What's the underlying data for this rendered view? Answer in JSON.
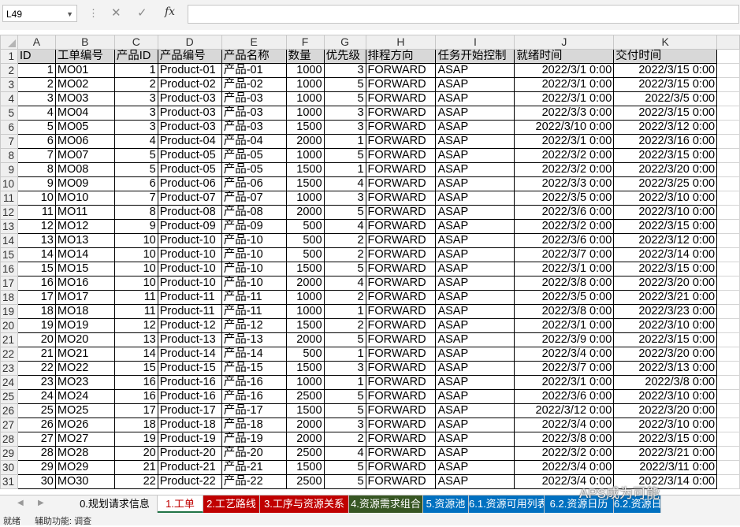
{
  "formula_bar": {
    "name_box": "L49",
    "fx_label": "fx",
    "formula": ""
  },
  "columns": [
    "A",
    "B",
    "C",
    "D",
    "E",
    "F",
    "G",
    "H",
    "I",
    "J",
    "K"
  ],
  "row_numbers": [
    "1",
    "2",
    "3",
    "4",
    "5",
    "6",
    "7",
    "8",
    "9",
    "10",
    "11",
    "12",
    "13",
    "14",
    "15",
    "16",
    "17",
    "18",
    "19",
    "20",
    "21",
    "22",
    "23",
    "24",
    "25",
    "26",
    "27",
    "28",
    "29",
    "30",
    "31"
  ],
  "header": [
    "ID",
    "工单编号",
    "产品ID",
    "产品编号",
    "产品名称",
    "数量",
    "优先级",
    "排程方向",
    "任务开始控制",
    "就绪时间",
    "交付时间"
  ],
  "rows": [
    [
      "1",
      "MO01",
      "1",
      "Product-01",
      "产品-01",
      "1000",
      "3",
      "FORWARD",
      "ASAP",
      "2022/3/1 0:00",
      "2022/3/15 0:00"
    ],
    [
      "2",
      "MO02",
      "2",
      "Product-02",
      "产品-02",
      "1000",
      "5",
      "FORWARD",
      "ASAP",
      "2022/3/1 0:00",
      "2022/3/15 0:00"
    ],
    [
      "3",
      "MO03",
      "3",
      "Product-03",
      "产品-03",
      "1000",
      "5",
      "FORWARD",
      "ASAP",
      "2022/3/1 0:00",
      "2022/3/5 0:00"
    ],
    [
      "4",
      "MO04",
      "3",
      "Product-03",
      "产品-03",
      "1000",
      "3",
      "FORWARD",
      "ASAP",
      "2022/3/3 0:00",
      "2022/3/15 0:00"
    ],
    [
      "5",
      "MO05",
      "3",
      "Product-03",
      "产品-03",
      "1500",
      "3",
      "FORWARD",
      "ASAP",
      "2022/3/10 0:00",
      "2022/3/12 0:00"
    ],
    [
      "6",
      "MO06",
      "4",
      "Product-04",
      "产品-04",
      "2000",
      "1",
      "FORWARD",
      "ASAP",
      "2022/3/1 0:00",
      "2022/3/16 0:00"
    ],
    [
      "7",
      "MO07",
      "5",
      "Product-05",
      "产品-05",
      "1000",
      "5",
      "FORWARD",
      "ASAP",
      "2022/3/2 0:00",
      "2022/3/15 0:00"
    ],
    [
      "8",
      "MO08",
      "5",
      "Product-05",
      "产品-05",
      "1500",
      "1",
      "FORWARD",
      "ASAP",
      "2022/3/2 0:00",
      "2022/3/20 0:00"
    ],
    [
      "9",
      "MO09",
      "6",
      "Product-06",
      "产品-06",
      "1500",
      "4",
      "FORWARD",
      "ASAP",
      "2022/3/3 0:00",
      "2022/3/25 0:00"
    ],
    [
      "10",
      "MO10",
      "7",
      "Product-07",
      "产品-07",
      "1000",
      "3",
      "FORWARD",
      "ASAP",
      "2022/3/5 0:00",
      "2022/3/10 0:00"
    ],
    [
      "11",
      "MO11",
      "8",
      "Product-08",
      "产品-08",
      "2000",
      "5",
      "FORWARD",
      "ASAP",
      "2022/3/6 0:00",
      "2022/3/10 0:00"
    ],
    [
      "12",
      "MO12",
      "9",
      "Product-09",
      "产品-09",
      "500",
      "4",
      "FORWARD",
      "ASAP",
      "2022/3/2 0:00",
      "2022/3/15 0:00"
    ],
    [
      "13",
      "MO13",
      "10",
      "Product-10",
      "产品-10",
      "500",
      "2",
      "FORWARD",
      "ASAP",
      "2022/3/6 0:00",
      "2022/3/12 0:00"
    ],
    [
      "14",
      "MO14",
      "10",
      "Product-10",
      "产品-10",
      "500",
      "2",
      "FORWARD",
      "ASAP",
      "2022/3/7 0:00",
      "2022/3/14 0:00"
    ],
    [
      "15",
      "MO15",
      "10",
      "Product-10",
      "产品-10",
      "1500",
      "5",
      "FORWARD",
      "ASAP",
      "2022/3/1 0:00",
      "2022/3/15 0:00"
    ],
    [
      "16",
      "MO16",
      "10",
      "Product-10",
      "产品-10",
      "2000",
      "4",
      "FORWARD",
      "ASAP",
      "2022/3/8 0:00",
      "2022/3/20 0:00"
    ],
    [
      "17",
      "MO17",
      "11",
      "Product-11",
      "产品-11",
      "1000",
      "2",
      "FORWARD",
      "ASAP",
      "2022/3/5 0:00",
      "2022/3/21 0:00"
    ],
    [
      "18",
      "MO18",
      "11",
      "Product-11",
      "产品-11",
      "1000",
      "1",
      "FORWARD",
      "ASAP",
      "2022/3/8 0:00",
      "2022/3/23 0:00"
    ],
    [
      "19",
      "MO19",
      "12",
      "Product-12",
      "产品-12",
      "1500",
      "2",
      "FORWARD",
      "ASAP",
      "2022/3/1 0:00",
      "2022/3/10 0:00"
    ],
    [
      "20",
      "MO20",
      "13",
      "Product-13",
      "产品-13",
      "2000",
      "5",
      "FORWARD",
      "ASAP",
      "2022/3/9 0:00",
      "2022/3/15 0:00"
    ],
    [
      "21",
      "MO21",
      "14",
      "Product-14",
      "产品-14",
      "500",
      "1",
      "FORWARD",
      "ASAP",
      "2022/3/4 0:00",
      "2022/3/20 0:00"
    ],
    [
      "22",
      "MO22",
      "15",
      "Product-15",
      "产品-15",
      "1500",
      "3",
      "FORWARD",
      "ASAP",
      "2022/3/7 0:00",
      "2022/3/13 0:00"
    ],
    [
      "23",
      "MO23",
      "16",
      "Product-16",
      "产品-16",
      "1000",
      "1",
      "FORWARD",
      "ASAP",
      "2022/3/1 0:00",
      "2022/3/8 0:00"
    ],
    [
      "24",
      "MO24",
      "16",
      "Product-16",
      "产品-16",
      "2500",
      "5",
      "FORWARD",
      "ASAP",
      "2022/3/6 0:00",
      "2022/3/10 0:00"
    ],
    [
      "25",
      "MO25",
      "17",
      "Product-17",
      "产品-17",
      "1500",
      "5",
      "FORWARD",
      "ASAP",
      "2022/3/12 0:00",
      "2022/3/20 0:00"
    ],
    [
      "26",
      "MO26",
      "18",
      "Product-18",
      "产品-18",
      "2000",
      "3",
      "FORWARD",
      "ASAP",
      "2022/3/4 0:00",
      "2022/3/10 0:00"
    ],
    [
      "27",
      "MO27",
      "19",
      "Product-19",
      "产品-19",
      "2000",
      "2",
      "FORWARD",
      "ASAP",
      "2022/3/8 0:00",
      "2022/3/15 0:00"
    ],
    [
      "28",
      "MO28",
      "20",
      "Product-20",
      "产品-20",
      "2500",
      "4",
      "FORWARD",
      "ASAP",
      "2022/3/2 0:00",
      "2022/3/21 0:00"
    ],
    [
      "29",
      "MO29",
      "21",
      "Product-21",
      "产品-21",
      "1500",
      "5",
      "FORWARD",
      "ASAP",
      "2022/3/4 0:00",
      "2022/3/11 0:00"
    ],
    [
      "30",
      "MO30",
      "22",
      "Product-22",
      "产品-22",
      "2500",
      "5",
      "FORWARD",
      "ASAP",
      "2022/3/4 0:00",
      "2022/3/14 0:00"
    ]
  ],
  "sheet_tabs": [
    {
      "label": "0.规划请求信息",
      "bg": "#f3f3f3",
      "fg": "#000000",
      "active": false
    },
    {
      "label": "1.工单",
      "bg": "#ffffff",
      "fg": "#c00000",
      "active": true
    },
    {
      "label": "2.工艺路线",
      "bg": "#c00000",
      "fg": "#ffffff",
      "active": false
    },
    {
      "label": "3.工序与资源关系",
      "bg": "#c00000",
      "fg": "#ffffff",
      "active": false
    },
    {
      "label": "4.资源需求组合",
      "bg": "#375623",
      "fg": "#ffffff",
      "active": false
    },
    {
      "label": "5.资源池",
      "bg": "#0070c0",
      "fg": "#ffffff",
      "active": false
    },
    {
      "label": "6.1.资源可用列表",
      "bg": "#0070c0",
      "fg": "#ffffff",
      "active": false
    },
    {
      "label": "6.2.资源日历",
      "bg": "#0070c0",
      "fg": "#ffffff",
      "active": false
    },
    {
      "label": "6.2.资源日",
      "bg": "#0070c0",
      "fg": "#ffffff",
      "active": false
    }
  ],
  "status_bar": {
    "ready": "就绪",
    "accessibility": "辅助功能: 调查"
  },
  "watermark": "APS成为可能"
}
